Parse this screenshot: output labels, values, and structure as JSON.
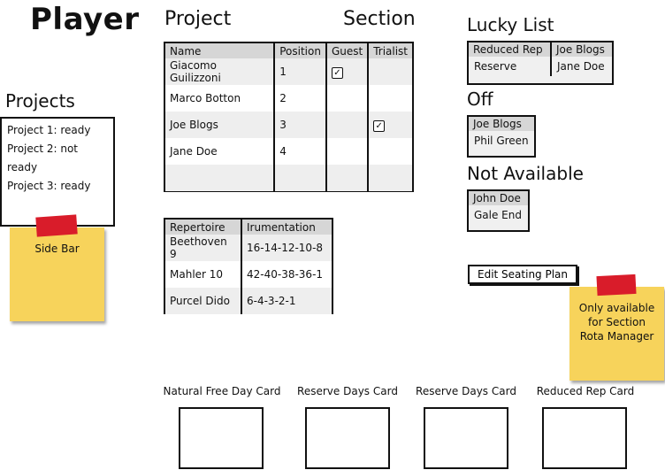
{
  "header": {
    "title": "Player"
  },
  "projects_panel": {
    "title": "Projects",
    "items": [
      "Project 1: ready",
      "Project 2: not ready",
      "Project 3: ready"
    ],
    "sticky_note": "Side Bar"
  },
  "main": {
    "project_heading": "Project",
    "section_heading": "Section",
    "players_table": {
      "columns": [
        "Name",
        "Position",
        "Guest",
        "Trialist"
      ],
      "rows": [
        {
          "name": "Giacomo Guilizzoni",
          "position": "1",
          "guest": true,
          "trialist": false
        },
        {
          "name": "Marco Botton",
          "position": "2",
          "guest": false,
          "trialist": false
        },
        {
          "name": "Joe Blogs",
          "position": "3",
          "guest": false,
          "trialist": true
        },
        {
          "name": "Jane Doe",
          "position": "4",
          "guest": false,
          "trialist": false
        },
        {
          "name": "",
          "position": "",
          "guest": false,
          "trialist": false
        }
      ]
    },
    "repertoire_table": {
      "columns": [
        "Repertoire",
        "Irumentation"
      ],
      "rows": [
        [
          "Beethoven 9",
          "16-14-12-10-8"
        ],
        [
          "Mahler 10",
          "42-40-38-36-1"
        ],
        [
          "Purcel Dido",
          "6-4-3-2-1"
        ]
      ]
    }
  },
  "right_panel": {
    "lucky_list": {
      "title": "Lucky List",
      "headers": [
        "Reduced Rep",
        "Joe Blogs"
      ],
      "values": [
        "Reserve",
        "Jane Doe"
      ]
    },
    "off": {
      "title": "Off",
      "header": "Joe Blogs",
      "value": "Phil Green"
    },
    "not_available": {
      "title": "Not Available",
      "header": "John Doe",
      "value": "Gale End"
    },
    "edit_button": "Edit Seating Plan",
    "sticky_note": [
      "Only available",
      "for Section",
      "Rota Manager"
    ]
  },
  "cards": [
    {
      "label": "Natural Free Day Card"
    },
    {
      "label": "Reserve Days Card"
    },
    {
      "label": "Reserve Days Card"
    },
    {
      "label": "Reduced Rep Card"
    }
  ],
  "colors": {
    "sticky": "#f7d35b",
    "tape": "#d91c2a",
    "header_gray": "#d6d6d6"
  }
}
